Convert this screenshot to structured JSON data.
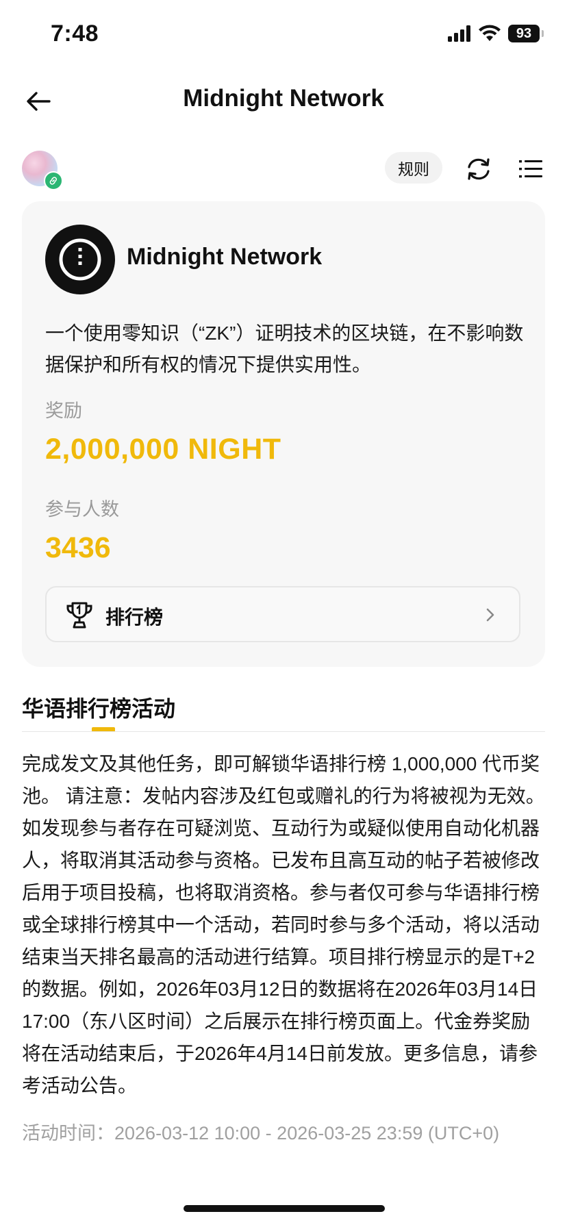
{
  "status_bar": {
    "time": "7:48",
    "battery": "93"
  },
  "header": {
    "title": "Midnight Network"
  },
  "toolbar": {
    "rules_label": "规则"
  },
  "project": {
    "name": "Midnight Network",
    "description": "一个使用零知识（“ZK”）证明技术的区块链，在不影响数据保护和所有权的情况下提供实用性。"
  },
  "reward": {
    "label": "奖励",
    "value": "2,000,000 NIGHT"
  },
  "participants": {
    "label": "参与人数",
    "value": "3436"
  },
  "leaderboard": {
    "label": "排行榜"
  },
  "section": {
    "tab_label": "华语排行榜活动",
    "body": "完成发文及其他任务，即可解锁华语排行榜 1,000,000 代币奖池。 请注意：发帖内容涉及红包或赠礼的行为将被视为无效。如发现参与者存在可疑浏览、互动行为或疑似使用自动化机器人，将取消其活动参与资格。已发布且高互动的帖子若被修改后用于项目投稿，也将取消资格。参与者仅可参与华语排行榜或全球排行榜其中一个活动，若同时参与多个活动，将以活动结束当天排名最高的活动进行结算。项目排行榜显示的是T+2的数据。例如，2026年03月12日的数据将在2026年03月14日17:00（东八区时间）之后展示在排行榜页面上。代金券奖励将在活动结束后，于2026年4月14日前发放。更多信息，请参考活动公告。",
    "time_label": "活动时间：",
    "time_range": "2026-03-12 10:00 - 2026-03-25 23:59 (UTC+0)"
  },
  "colors": {
    "accent": "#f0b90b",
    "badge": "#2bb673"
  },
  "icons": [
    "back-arrow-icon",
    "refresh-icon",
    "list-menu-icon",
    "trophy-icon",
    "chevron-right-icon",
    "link-icon",
    "midnight-logo-icon"
  ]
}
